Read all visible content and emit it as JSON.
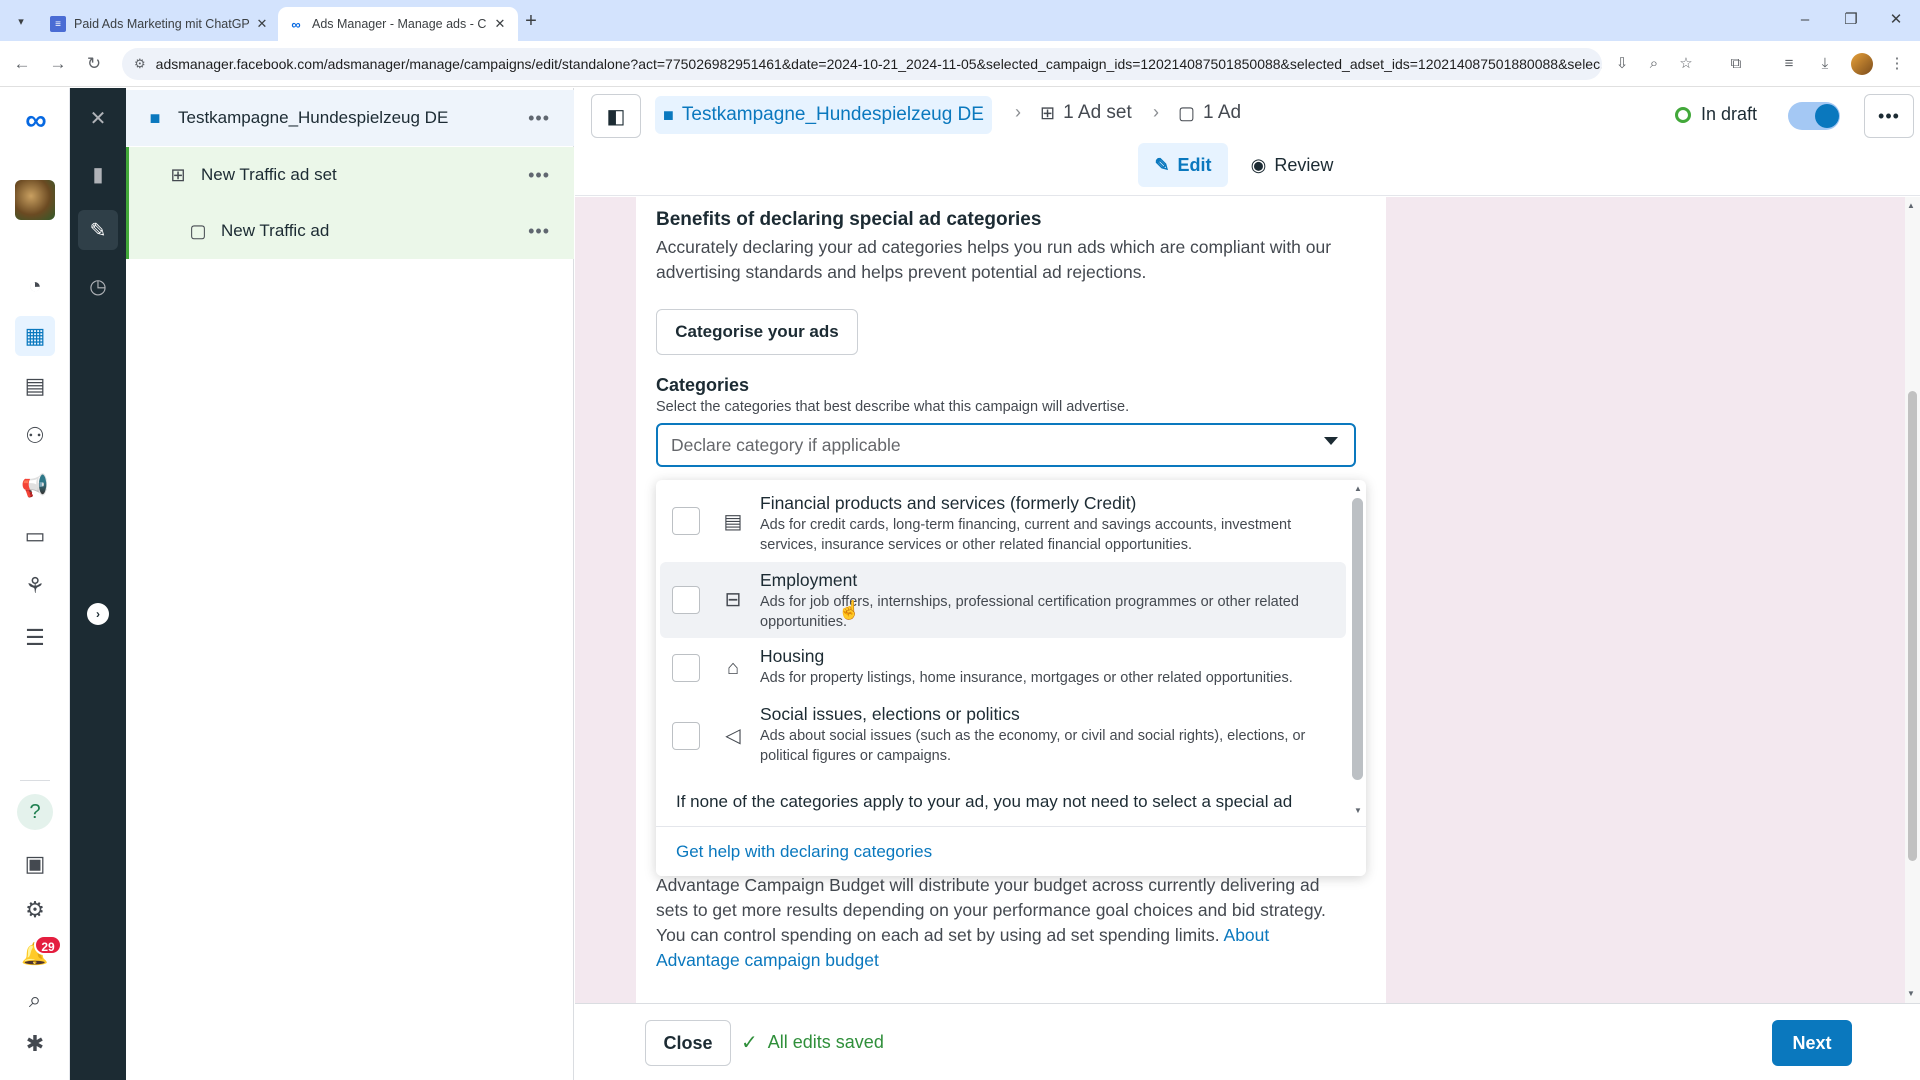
{
  "browser": {
    "tabs": [
      {
        "title": "Paid Ads Marketing mit ChatGP",
        "active": false
      },
      {
        "title": "Ads Manager - Manage ads - C",
        "active": true
      }
    ],
    "url": "adsmanager.facebook.com/adsmanager/manage/campaigns/edit/standalone?act=775026982951461&date=2024-10-21_2024-11-05&selected_campaign_ids=120214087501850088&selected_adset_ids=120214087501880088&selec..."
  },
  "rail": {
    "notification_count": "29"
  },
  "tree": {
    "campaign": "Testkampagne_Hundespielzeug DE",
    "adset": "New Traffic ad set",
    "ad": "New Traffic ad"
  },
  "header": {
    "campaign_crumb": "Testkampagne_Hundespielzeug DE",
    "adset_crumb": "1 Ad set",
    "ad_crumb": "1 Ad",
    "status": "In draft",
    "edit_label": "Edit",
    "review_label": "Review"
  },
  "content": {
    "benefits_title": "Benefits of declaring special ad categories",
    "benefits_text": "Accurately declaring your ad categories helps you run ads which are compliant with our advertising standards and helps prevent potential ad rejections.",
    "categorise_button": "Categorise your ads",
    "categories_title": "Categories",
    "categories_hint": "Select the categories that best describe what this campaign will advertise.",
    "select_placeholder": "Declare category if applicable",
    "budget_text": "Advantage Campaign Budget will distribute your budget across currently delivering ad sets to get more results depending on your performance goal choices and bid strategy. You can control spending on each ad set by using ad set spending limits. ",
    "budget_link": "About Advantage campaign budget"
  },
  "dropdown": {
    "options": [
      {
        "title": "Financial products and services (formerly Credit)",
        "desc": "Ads for credit cards, long-term financing, current and savings accounts, investment services, insurance services or other related financial opportunities.",
        "icon": "bank-icon"
      },
      {
        "title": "Employment",
        "desc": "Ads for job offers, internships, professional certification programmes or other related opportunities.",
        "icon": "briefcase-icon"
      },
      {
        "title": "Housing",
        "desc": "Ads for property listings, home insurance, mortgages or other related opportunities.",
        "icon": "house-icon"
      },
      {
        "title": "Social issues, elections or politics",
        "desc": "Ads about social issues (such as the economy, or civil and social rights), elections, or political figures or campaigns.",
        "icon": "megaphone-icon"
      }
    ],
    "footer_text": "If none of the categories apply to your ad, you may not need to select a special ad",
    "help_link": "Get help with declaring categories"
  },
  "footer": {
    "close_label": "Close",
    "saved_label": "All edits saved",
    "next_label": "Next"
  },
  "colors": {
    "accent": "#0a78be",
    "success": "#42a83a",
    "dark_strip": "#1c2b33",
    "badge": "#e41e3f"
  }
}
